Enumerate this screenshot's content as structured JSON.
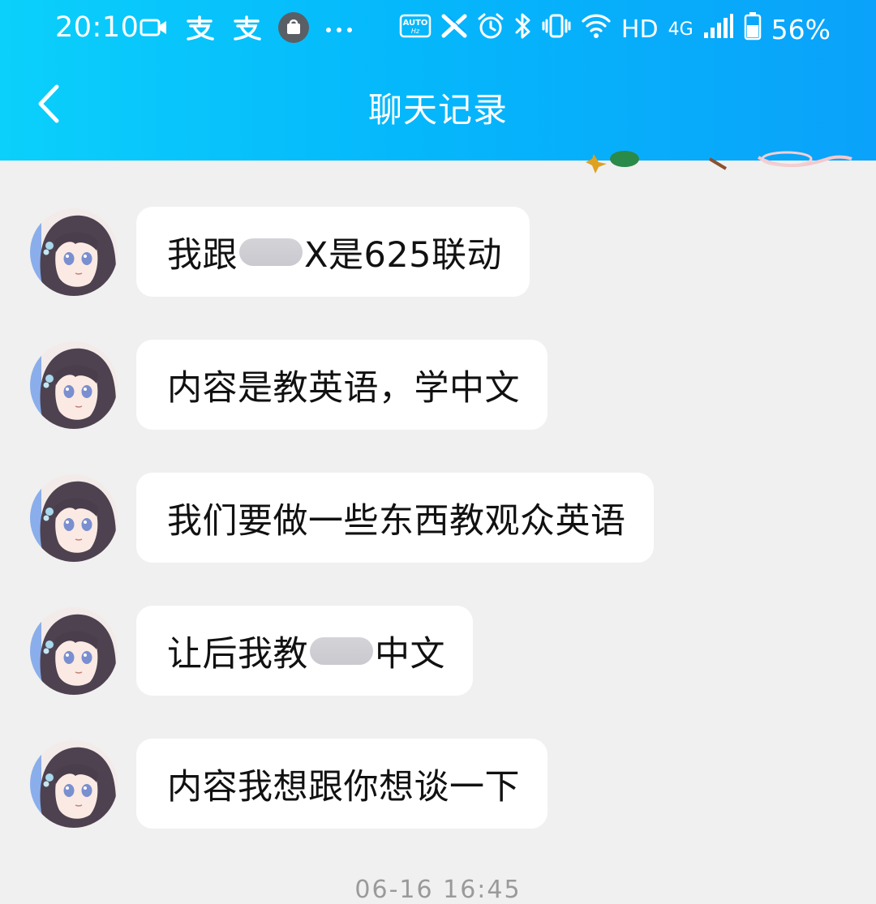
{
  "status_bar": {
    "time": "20:10",
    "network": "HD",
    "network_type": "4G",
    "battery": "56%"
  },
  "header": {
    "title": "聊天记录"
  },
  "messages": [
    {
      "parts": [
        "我跟",
        "X是625联动"
      ]
    },
    {
      "parts": [
        "内容是教英语，学中文",
        ""
      ]
    },
    {
      "parts": [
        "我们要做一些东西教观众英语",
        ""
      ]
    },
    {
      "parts": [
        "让后我教",
        "中文"
      ]
    },
    {
      "parts": [
        "内容我想跟你想谈一下",
        ""
      ]
    }
  ],
  "timestamp": "06-16 16:45",
  "colors": {
    "header_gradient_start": "#0bd0fb",
    "header_gradient_end": "#0aa2fa",
    "background": "#f0f0f0",
    "bubble": "#ffffff"
  },
  "icons": [
    "video-icon",
    "alipay-icon",
    "alipay-icon",
    "shopping-icon",
    "more-icon",
    "auto-hz-icon",
    "x-icon",
    "alarm-icon",
    "bluetooth-icon",
    "vibrate-icon",
    "wifi-icon",
    "signal-icon",
    "battery-icon",
    "back-icon"
  ]
}
